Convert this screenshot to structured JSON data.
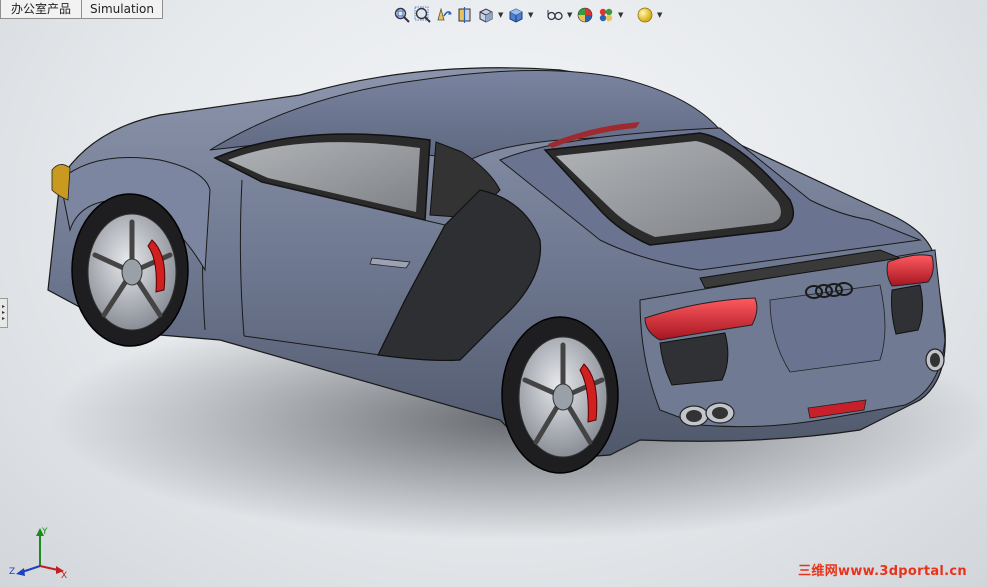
{
  "tabs": [
    {
      "label": "办公室产品"
    },
    {
      "label": "Simulation"
    }
  ],
  "heads_up_toolbar": {
    "buttons": [
      {
        "name": "zoom-to-fit-icon"
      },
      {
        "name": "zoom-to-area-icon"
      },
      {
        "name": "previous-view-icon"
      },
      {
        "name": "section-view-icon"
      },
      {
        "name": "view-orientation-icon",
        "dropdown": true
      },
      {
        "name": "display-style-icon",
        "dropdown": true
      },
      {
        "name": "hide-show-items-icon",
        "dropdown": true
      },
      {
        "name": "edit-appearance-icon"
      },
      {
        "name": "apply-scene-icon",
        "dropdown": true
      },
      {
        "name": "view-settings-icon",
        "dropdown": true
      }
    ]
  },
  "triad": {
    "axes": [
      "Y",
      "Z",
      "X"
    ]
  },
  "colors": {
    "car_body": "#6e7890",
    "glass": "#3a3a3a",
    "tail_light": "#c8202a",
    "brake_caliper": "#d02020",
    "watermark": "#e8331c"
  },
  "watermark": {
    "text": "三维网www.3dportal.cn"
  }
}
